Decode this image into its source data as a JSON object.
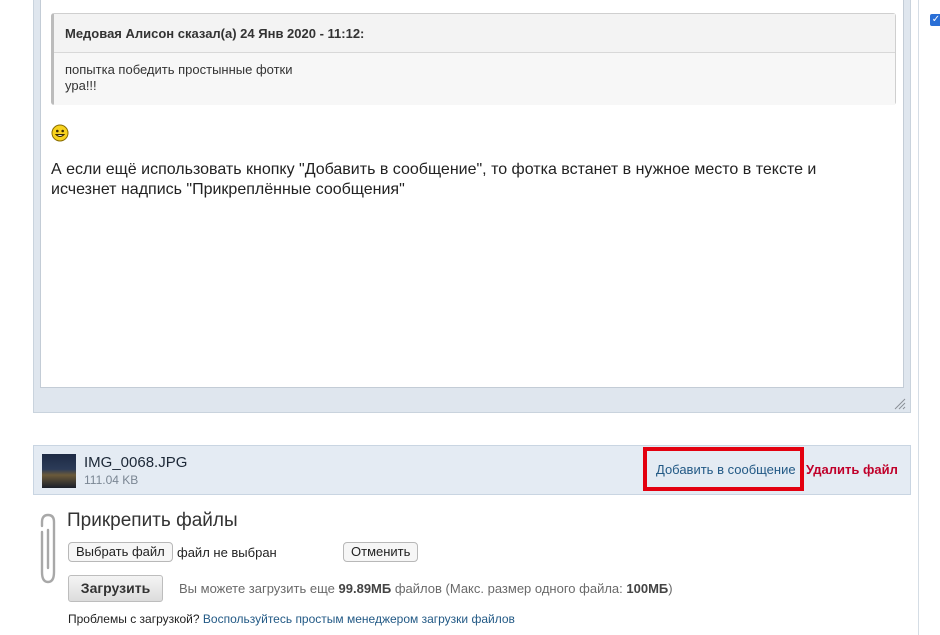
{
  "quote": {
    "author_line": "Медовая Алисон сказал(а) 24 Янв 2020 - 11:12:",
    "line1": "попытка победить простынные фотки",
    "line2": "ура!!!"
  },
  "post": {
    "text": "А если ещё использовать кнопку \"Добавить в сообщение\", то фотка встанет в нужное место в тексте и исчезнет надпись \"Прикреплённые сообщения\""
  },
  "attachment": {
    "file_name": "IMG_0068.JPG",
    "file_size": "111.04 KB",
    "add_label": "Добавить в сообщение",
    "delete_label": "Удалить файл"
  },
  "attach_section": {
    "title": "Прикрепить файлы",
    "choose_label": "Выбрать файл",
    "no_file_label": "файл не выбран",
    "cancel_label": "Отменить",
    "upload_label": "Загрузить",
    "info_prefix": "Вы можете загрузить еще",
    "remaining": "99.89МБ",
    "info_middle": "файлов (Макс. размер одного файла:",
    "max_size": "100МБ",
    "info_suffix": ")",
    "problems_text": "Проблемы с загрузкой?",
    "problems_link": "Воспользуйтесь простым менеджером загрузки файлов"
  },
  "colors": {
    "highlight": "#e3000f",
    "link": "#225985",
    "delete": "#c0002a"
  },
  "icons": [
    "smiley-icon",
    "paperclip-icon",
    "resize-grip-icon",
    "checkbox-icon"
  ]
}
